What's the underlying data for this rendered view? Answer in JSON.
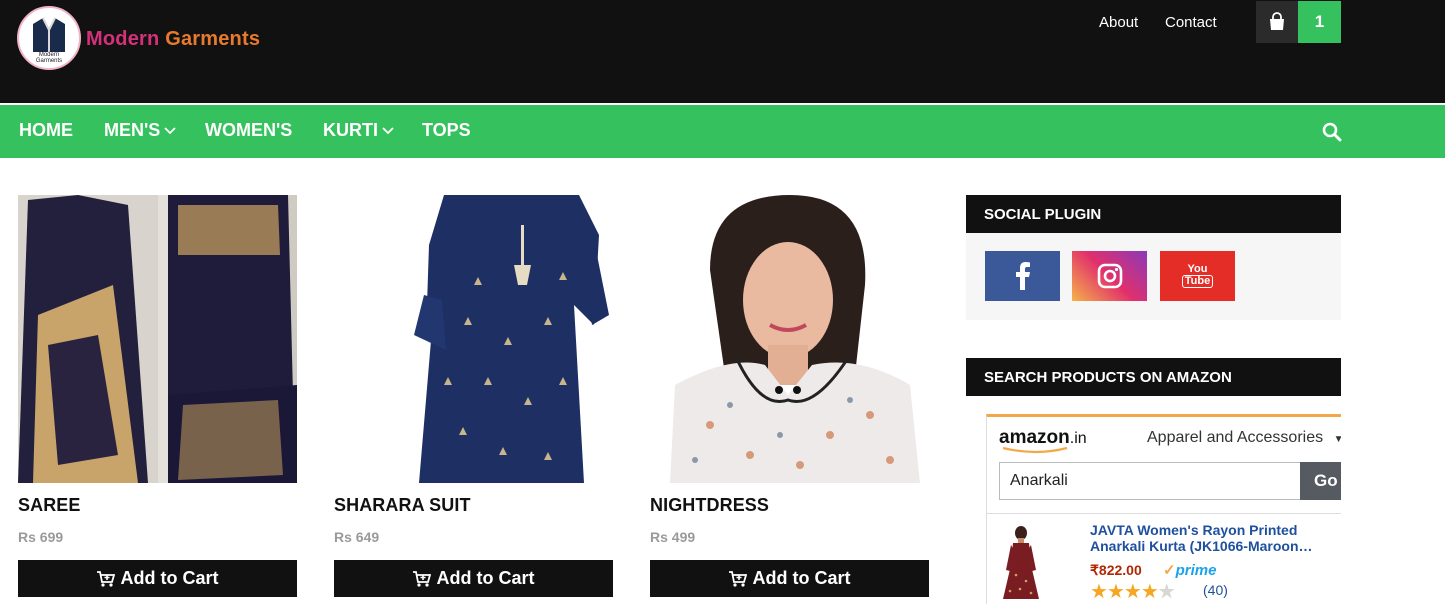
{
  "brand": {
    "name_part1": "Modern ",
    "name_part2": "Garments",
    "badge_text": "Modern Garments"
  },
  "top_links": [
    "About",
    "Contact"
  ],
  "cart": {
    "count": "1",
    "icon": "shopping-bag-icon"
  },
  "nav": [
    {
      "label": "HOME",
      "dropdown": false
    },
    {
      "label": "MEN'S",
      "dropdown": true
    },
    {
      "label": "WOMEN'S",
      "dropdown": false
    },
    {
      "label": "KURTI",
      "dropdown": true
    },
    {
      "label": "TOPS",
      "dropdown": false
    }
  ],
  "products": [
    {
      "title": "SAREE",
      "price": "Rs 699",
      "button": "Add to Cart"
    },
    {
      "title": "SHARARA SUIT",
      "price": "Rs 649",
      "button": "Add to Cart"
    },
    {
      "title": "NIGHTDRESS",
      "price": "Rs 499",
      "button": "Add to Cart"
    }
  ],
  "sidebar": {
    "social_title": "SOCIAL PLUGIN",
    "social": [
      {
        "name": "facebook",
        "color": "#3b5998"
      },
      {
        "name": "instagram",
        "color": "#d6249f"
      },
      {
        "name": "youtube",
        "color": "#e52d27",
        "text_top": "You",
        "text_bottom": "Tube"
      }
    ],
    "amazon_title": "SEARCH PRODUCTS ON AMAZON",
    "amazon": {
      "logo": "amazon",
      "logo_suffix": ".in",
      "category": "Apparel and Accessories",
      "query": "Anarkali",
      "go": "Go",
      "item_title": "JAVTA Women's Rayon Printed Anarkali Kurta (JK1066-Maroon…",
      "item_price": "₹822.00",
      "prime": "prime",
      "rating": 4.5,
      "reviews": "(40)"
    }
  },
  "colors": {
    "green": "#35c15e",
    "dark": "#111111",
    "price_gray": "#9a9a9a"
  }
}
